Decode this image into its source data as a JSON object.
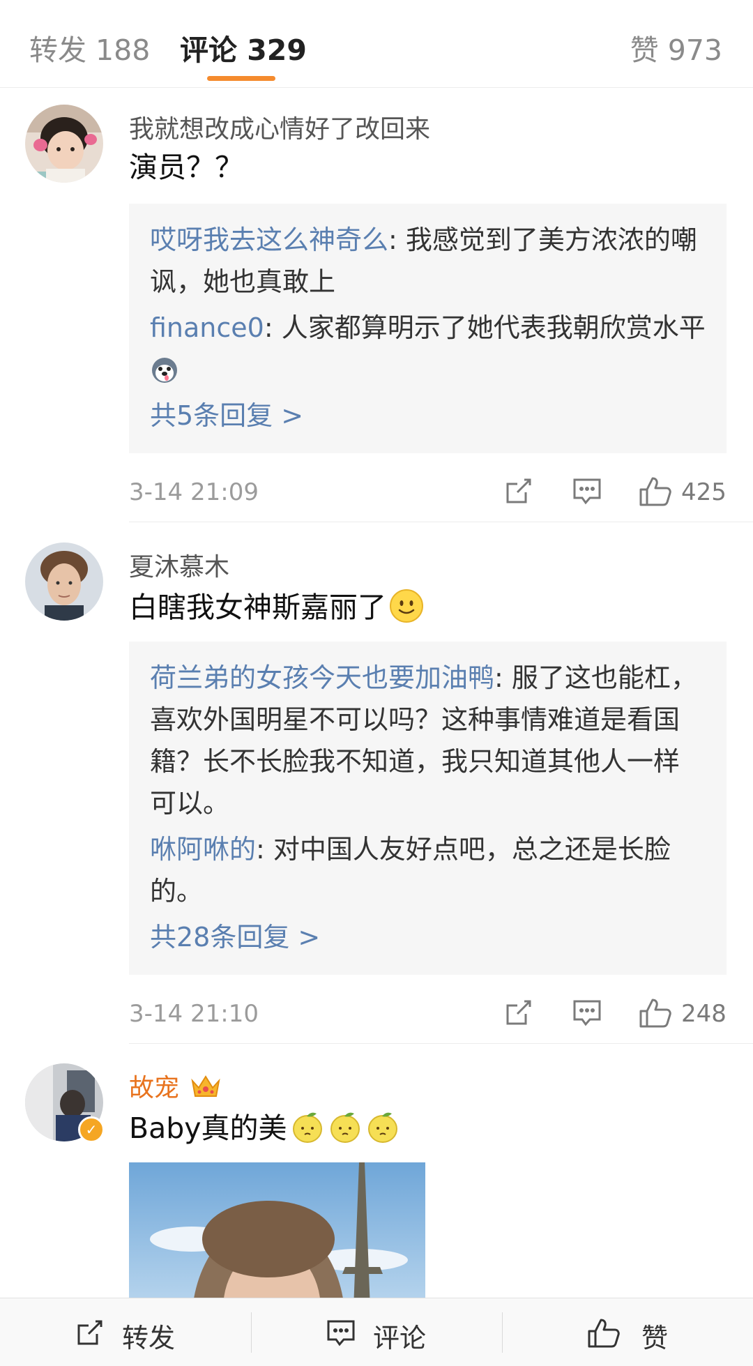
{
  "tabs": {
    "repost": "转发 188",
    "comments": "评论 329",
    "likes": "赞 973"
  },
  "comments": [
    {
      "username": "我就想改成心情好了改回来",
      "text": "演员？？",
      "replies": [
        {
          "name": "哎呀我去这么神奇么",
          "text": ": 我感觉到了美方浓浓的嘲讽，她也真敢上"
        },
        {
          "name": "finance0",
          "text": ": 人家都算明示了她代表我朝欣赏水平"
        }
      ],
      "more": "共5条回复 >",
      "time": "3-14 21:09",
      "likes": "425"
    },
    {
      "username": "夏沐慕木",
      "text": "白瞎我女神斯嘉丽了",
      "replies": [
        {
          "name": "荷兰弟的女孩今天也要加油鸭",
          "text": ": 服了这也能杠，喜欢外国明星不可以吗？这种事情难道是看国籍？长不长脸我不知道，我只知道其他人一样可以。"
        },
        {
          "name": "咻阿咻的",
          "text": ": 对中国人友好点吧，总之还是长脸的。"
        }
      ],
      "more": "共28条回复 >",
      "time": "3-14 21:10",
      "likes": "248"
    },
    {
      "username": "故宠",
      "text": "Baby真的美"
    }
  ],
  "bottom_bar": {
    "repost": "转发",
    "comment": "评论",
    "like": "赞"
  },
  "colors": {
    "accent": "#f58b2e",
    "link": "#5a7fb0",
    "vip_name": "#e8731e"
  }
}
